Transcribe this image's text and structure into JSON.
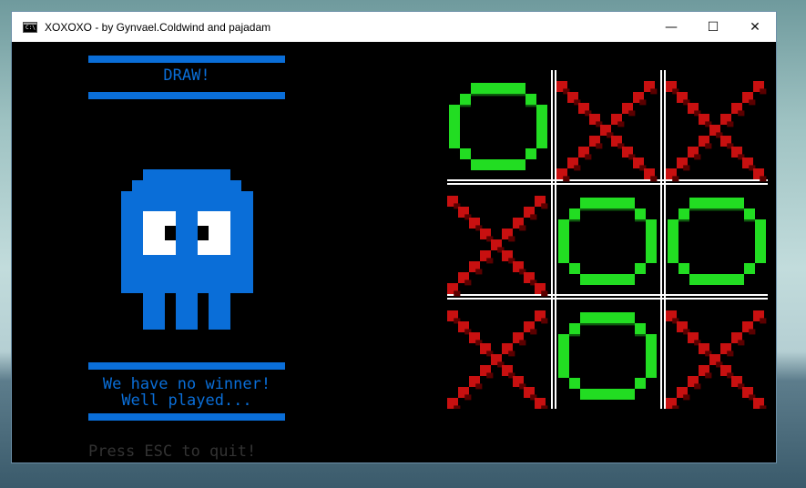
{
  "window": {
    "title": "XOXOXO - by Gynvael.Coldwind and pajadam",
    "app_icon_text": "C:\\",
    "controls": {
      "minimize": "—",
      "maximize": "☐",
      "close": "✕"
    }
  },
  "game": {
    "result": "DRAW!",
    "message_line1": "We have no winner!",
    "message_line2": "Well played...",
    "quit_hint": "Press ESC to quit!",
    "board": [
      "O",
      "X",
      "X",
      "X",
      "O",
      "O",
      "X",
      "O",
      "X"
    ],
    "colors": {
      "accent_blue": "#0a6ed8",
      "o_green": "#22dd22",
      "o_shadow": "#0d5a0d",
      "x_red": "#c81010",
      "x_shadow": "#5a0000",
      "grid": "#ffffff",
      "background": "#000000",
      "quit_text": "#333333"
    }
  }
}
